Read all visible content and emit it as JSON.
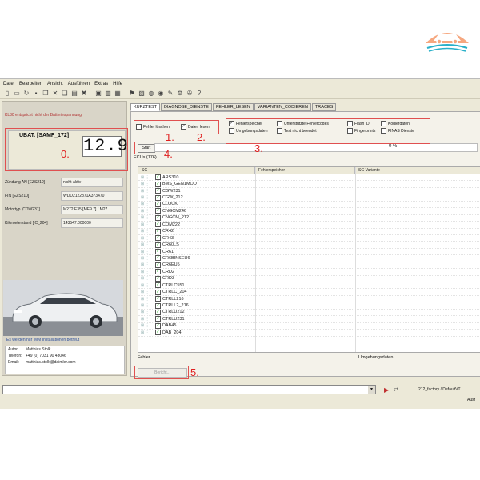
{
  "menu": [
    "Datei",
    "Bearbeiten",
    "Ansicht",
    "Ausführen",
    "Extras",
    "Hilfe"
  ],
  "left": {
    "warning": "KL30 entspricht nicht der Batteriespannung",
    "ubat_label": "UBAT. [SAMF_172]",
    "ubat_value": "12.9",
    "info": [
      {
        "k": "Zündung AN [EZS210]",
        "v": "nicht aktiv"
      },
      {
        "k": "FIN [EZS210]",
        "v": "WDD2122871A373470"
      },
      {
        "k": "Motortyp [CDW231]",
        "v": "M272 E35 [ME9.7] / M27"
      },
      {
        "k": "Kilometerstand [IC_204]",
        "v": "143547.000000"
      }
    ],
    "imm_text": "Es werden nur IMM Installationen betreut",
    "author": [
      {
        "k": "Autor:",
        "v": "Matthias Stolk"
      },
      {
        "k": "Telefon:",
        "v": "+49 (0) 7031 90 43046"
      },
      {
        "k": "Email:",
        "v": "matthias.stolk@daimler.com"
      }
    ]
  },
  "tabs": [
    {
      "label": "KURZTEST",
      "active": true
    },
    {
      "label": "DIAGNOSE_DIENSTE",
      "active": false
    },
    {
      "label": "FEHLER_LESEN",
      "active": false
    },
    {
      "label": "VARIANTEN_CODIEREN",
      "active": false
    },
    {
      "label": "TRACES",
      "active": false
    }
  ],
  "options": {
    "fehler_loeschen": "Fehler löschen",
    "daten_lesen": "Daten lesen",
    "row1": [
      "Fehlerspeicher",
      "Unterstützte Fehlercodes",
      "Flash ID",
      "Kodierdaten"
    ],
    "row2": [
      "Umgebungsdaten",
      "Test nicht beendet",
      "Fingerprints",
      "FINAS Dienste"
    ]
  },
  "start_label": "Start",
  "progress_text": "0 %",
  "progress_fraction": 0,
  "ecus_label": "ECUs (176)",
  "grid_headers": [
    "SG",
    "Fehlerspeicher",
    "SG Variante"
  ],
  "ecus": [
    "ARS310",
    "BMS_GEN1MOD",
    "CGW231",
    "CGW_212",
    "CLOCK",
    "CNGCM246",
    "CNGCM_212",
    "COM222",
    "CR42",
    "CR43",
    "CR60LS",
    "CR61",
    "CR6BINSEU6",
    "CR6EU5",
    "CRD2",
    "CRD3",
    "CTRLC551",
    "CTRLC_204",
    "CTRLL216",
    "CTRLL2_216",
    "CTRLU212",
    "CTRLU231",
    "DAB45",
    "DAB_204"
  ],
  "footer": {
    "fehler": "Fehler",
    "umgebungsdaten": "Umgebungsdaten",
    "bericht": "Bericht..."
  },
  "status_path": "212_factory / DefaultVT",
  "status_ausf": "Ausf",
  "annotations": [
    "0.",
    "1.",
    "2.",
    "3.",
    "4.",
    "5."
  ],
  "colors": {
    "annotation": "#e02020",
    "warning": "#b03030",
    "link": "#2a4d9a"
  }
}
